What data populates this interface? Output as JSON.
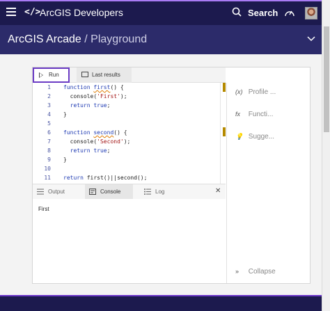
{
  "topbar": {
    "brand": "ArcGIS Developers",
    "search_label": "Search",
    "colors": {
      "background": "#1c1a4e",
      "accent": "#a97bf5"
    }
  },
  "subheader": {
    "title_main": "ArcGIS Arcade",
    "title_sep": " / ",
    "title_sub": "Playground"
  },
  "toolbar": {
    "run_label": "Run",
    "results_label": "Last results"
  },
  "editor": {
    "lines": [
      {
        "n": "1",
        "tokens": [
          [
            "kw",
            "function "
          ],
          [
            "fn",
            "first"
          ],
          [
            "plain",
            "() {"
          ]
        ]
      },
      {
        "n": "2",
        "tokens": [
          [
            "plain",
            "  console("
          ],
          [
            "str",
            "'First'"
          ],
          [
            "plain",
            ");"
          ]
        ]
      },
      {
        "n": "3",
        "tokens": [
          [
            "plain",
            "  "
          ],
          [
            "kw",
            "return "
          ],
          [
            "bool",
            "true"
          ],
          [
            "plain",
            ";"
          ]
        ]
      },
      {
        "n": "4",
        "tokens": [
          [
            "plain",
            "}"
          ]
        ]
      },
      {
        "n": "5",
        "tokens": []
      },
      {
        "n": "6",
        "tokens": [
          [
            "kw",
            "function "
          ],
          [
            "fn",
            "second"
          ],
          [
            "plain",
            "() {"
          ]
        ]
      },
      {
        "n": "7",
        "tokens": [
          [
            "plain",
            "  console("
          ],
          [
            "str",
            "'Second'"
          ],
          [
            "plain",
            ");"
          ]
        ]
      },
      {
        "n": "8",
        "tokens": [
          [
            "plain",
            "  "
          ],
          [
            "kw",
            "return "
          ],
          [
            "bool",
            "true"
          ],
          [
            "plain",
            ";"
          ]
        ]
      },
      {
        "n": "9",
        "tokens": [
          [
            "plain",
            "}"
          ]
        ]
      },
      {
        "n": "10",
        "tokens": []
      },
      {
        "n": "11",
        "tokens": [
          [
            "kw",
            "return "
          ],
          [
            "plain",
            "first()||second();"
          ]
        ]
      }
    ]
  },
  "side_panel": {
    "items": [
      {
        "icon": "(x)",
        "label": "Profile ..."
      },
      {
        "icon": "fx",
        "label": "Functi..."
      },
      {
        "icon": "💡",
        "label": "Sugge..."
      }
    ],
    "collapse_icon": "»",
    "collapse_label": "Collapse"
  },
  "bottom_tabs": {
    "tabs": [
      {
        "label": "Output"
      },
      {
        "label": "Console"
      },
      {
        "label": "Log"
      }
    ],
    "active": "Console",
    "close": "✕"
  },
  "console": {
    "output": "First"
  }
}
